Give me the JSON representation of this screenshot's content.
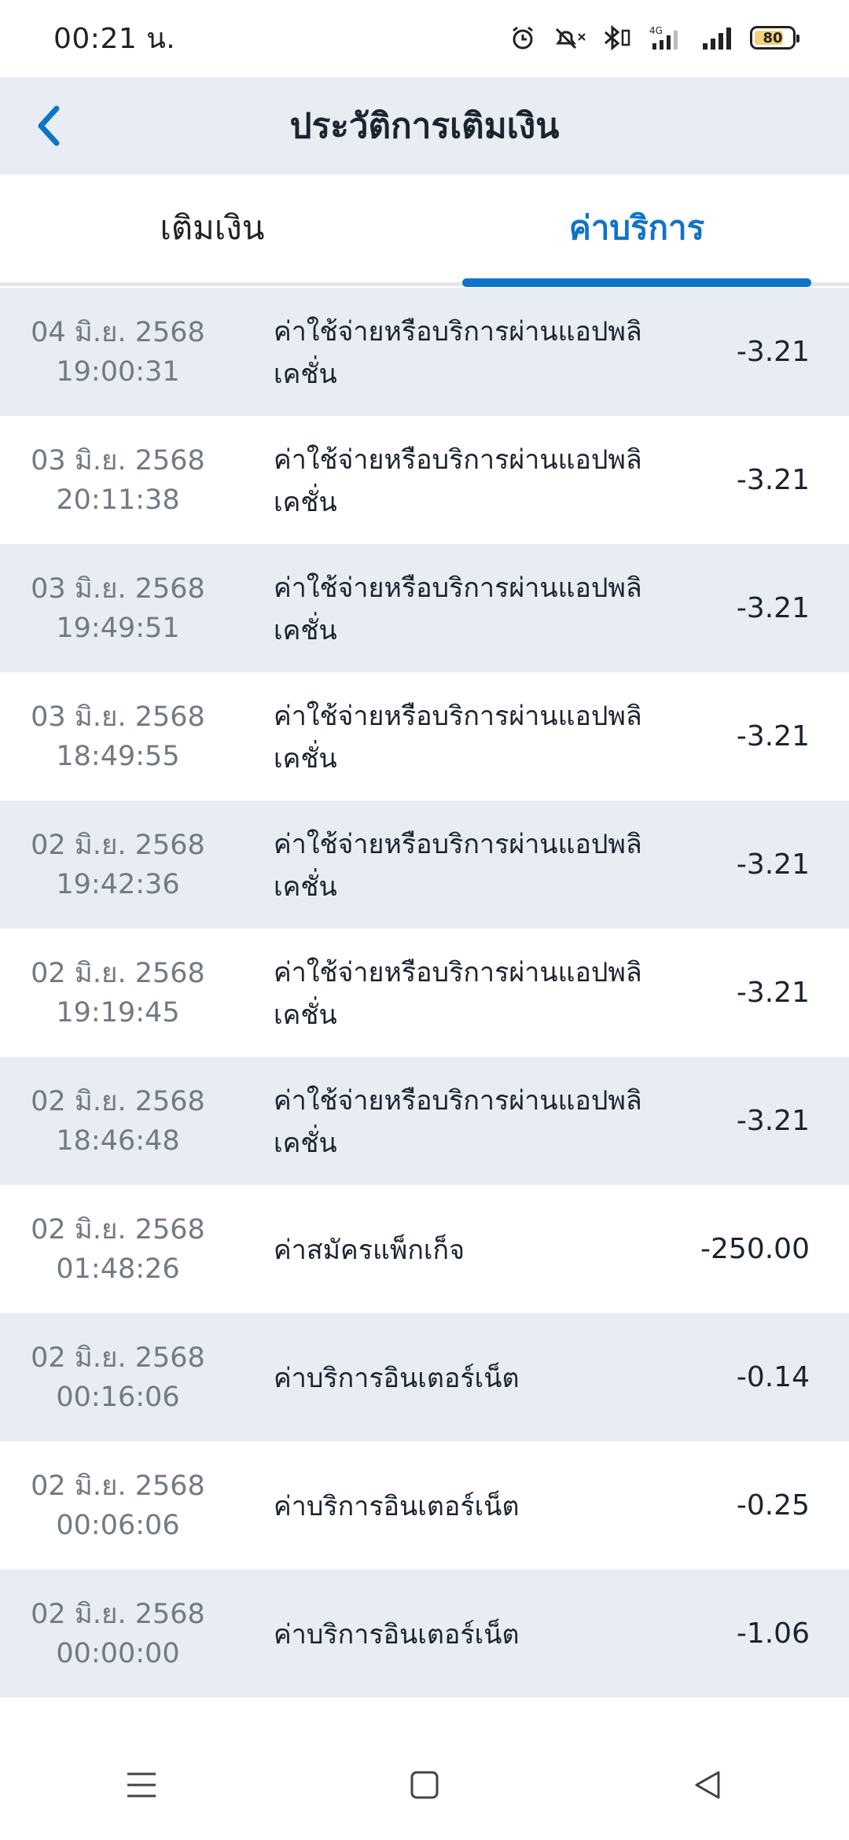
{
  "status_bar": {
    "time": "00:21 น.",
    "battery": "80"
  },
  "header": {
    "title": "ประวัติการเติมเงิน"
  },
  "tabs": [
    {
      "label": "เติมเงิน",
      "active": false
    },
    {
      "label": "ค่าบริการ",
      "active": true
    }
  ],
  "transactions": [
    {
      "date": "04 มิ.ย. 2568",
      "time": "19:00:31",
      "description": "ค่าใช้จ่ายหรือบริการผ่านแอปพลิเคชั่น",
      "amount": "-3.21"
    },
    {
      "date": "03 มิ.ย. 2568",
      "time": "20:11:38",
      "description": "ค่าใช้จ่ายหรือบริการผ่านแอปพลิเคชั่น",
      "amount": "-3.21"
    },
    {
      "date": "03 มิ.ย. 2568",
      "time": "19:49:51",
      "description": "ค่าใช้จ่ายหรือบริการผ่านแอปพลิเคชั่น",
      "amount": "-3.21"
    },
    {
      "date": "03 มิ.ย. 2568",
      "time": "18:49:55",
      "description": "ค่าใช้จ่ายหรือบริการผ่านแอปพลิเคชั่น",
      "amount": "-3.21"
    },
    {
      "date": "02 มิ.ย. 2568",
      "time": "19:42:36",
      "description": "ค่าใช้จ่ายหรือบริการผ่านแอปพลิเคชั่น",
      "amount": "-3.21"
    },
    {
      "date": "02 มิ.ย. 2568",
      "time": "19:19:45",
      "description": "ค่าใช้จ่ายหรือบริการผ่านแอปพลิเคชั่น",
      "amount": "-3.21"
    },
    {
      "date": "02 มิ.ย. 2568",
      "time": "18:46:48",
      "description": "ค่าใช้จ่ายหรือบริการผ่านแอปพลิเคชั่น",
      "amount": "-3.21"
    },
    {
      "date": "02 มิ.ย. 2568",
      "time": "01:48:26",
      "description": "ค่าสมัครแพ็กเก็จ",
      "amount": "-250.00"
    },
    {
      "date": "02 มิ.ย. 2568",
      "time": "00:16:06",
      "description": "ค่าบริการอินเตอร์เน็ต",
      "amount": "-0.14"
    },
    {
      "date": "02 มิ.ย. 2568",
      "time": "00:06:06",
      "description": "ค่าบริการอินเตอร์เน็ต",
      "amount": "-0.25"
    },
    {
      "date": "02 มิ.ย. 2568",
      "time": "00:00:00",
      "description": "ค่าบริการอินเตอร์เน็ต",
      "amount": "-1.06"
    }
  ],
  "colors": {
    "accent": "#0e74c8",
    "shaded_row": "#e7edf3",
    "header_bg": "#e7edf3"
  },
  "icons": {
    "back": "chevron-left-icon",
    "menu": "menu-icon",
    "home": "home-square-icon",
    "nav_back": "triangle-back-icon"
  }
}
